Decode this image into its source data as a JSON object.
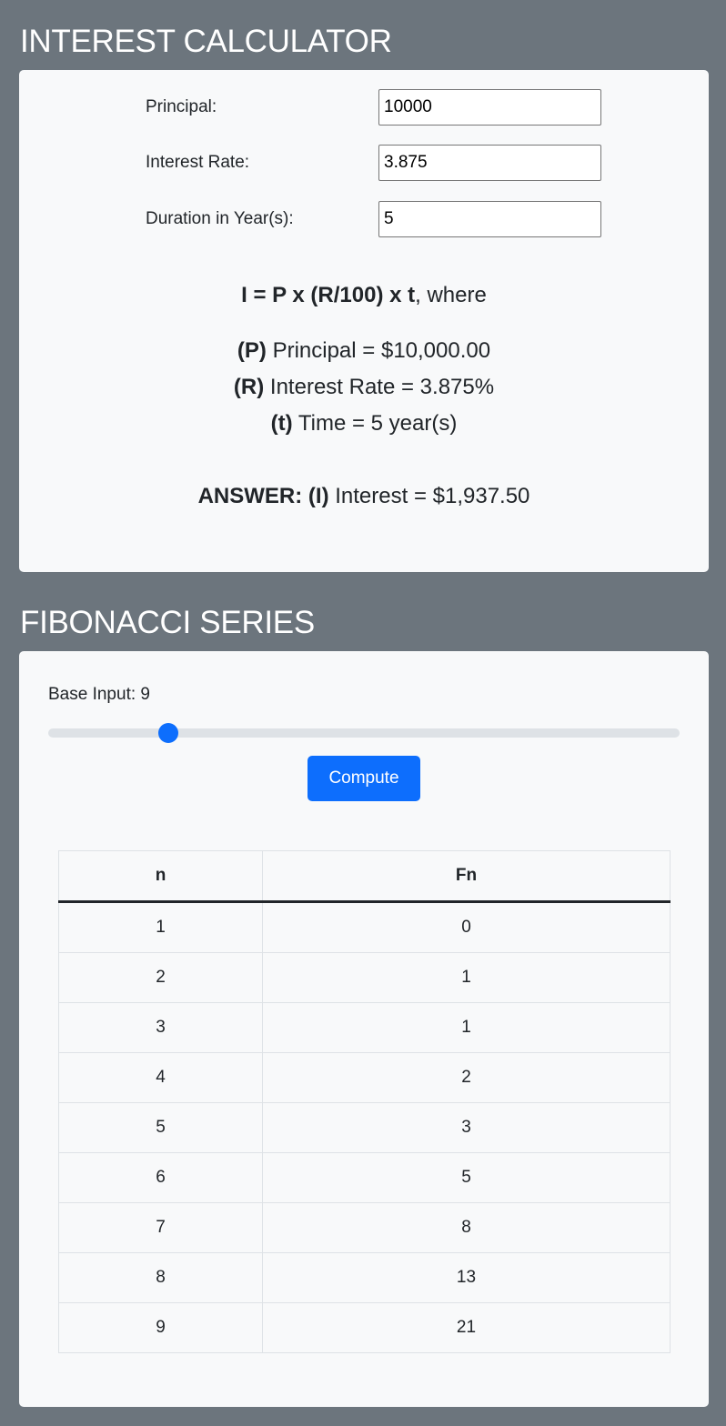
{
  "colors": {
    "page_background": "#6c757d",
    "card_background": "#f8f9fa",
    "accent": "#0d6efd",
    "slider_track": "#dee2e6"
  },
  "interest": {
    "title": "INTEREST CALCULATOR",
    "principal_label": "Principal:",
    "principal_value": "10000",
    "rate_label": "Interest Rate:",
    "rate_value": "3.875",
    "duration_label": "Duration in Year(s):",
    "duration_value": "5",
    "formula_bold": "I = P x (R/100) x t",
    "formula_suffix": ", where",
    "p_key": "(P)",
    "p_text": " Principal = $10,000.00",
    "r_key": "(R)",
    "r_text": " Interest Rate = 3.875%",
    "t_key": "(t)",
    "t_text": " Time = 5 year(s)",
    "answer_key": "ANSWER: (I)",
    "answer_text": " Interest = $1,937.50"
  },
  "fibonacci": {
    "title": "FIBONACCI SERIES",
    "base_input_label": "Base Input: 9",
    "slider_fraction": 0.19,
    "compute_label": "Compute",
    "table": {
      "headers": [
        "n",
        "Fn"
      ],
      "rows": [
        [
          "1",
          "0"
        ],
        [
          "2",
          "1"
        ],
        [
          "3",
          "1"
        ],
        [
          "4",
          "2"
        ],
        [
          "5",
          "3"
        ],
        [
          "6",
          "5"
        ],
        [
          "7",
          "8"
        ],
        [
          "8",
          "13"
        ],
        [
          "9",
          "21"
        ]
      ]
    }
  }
}
